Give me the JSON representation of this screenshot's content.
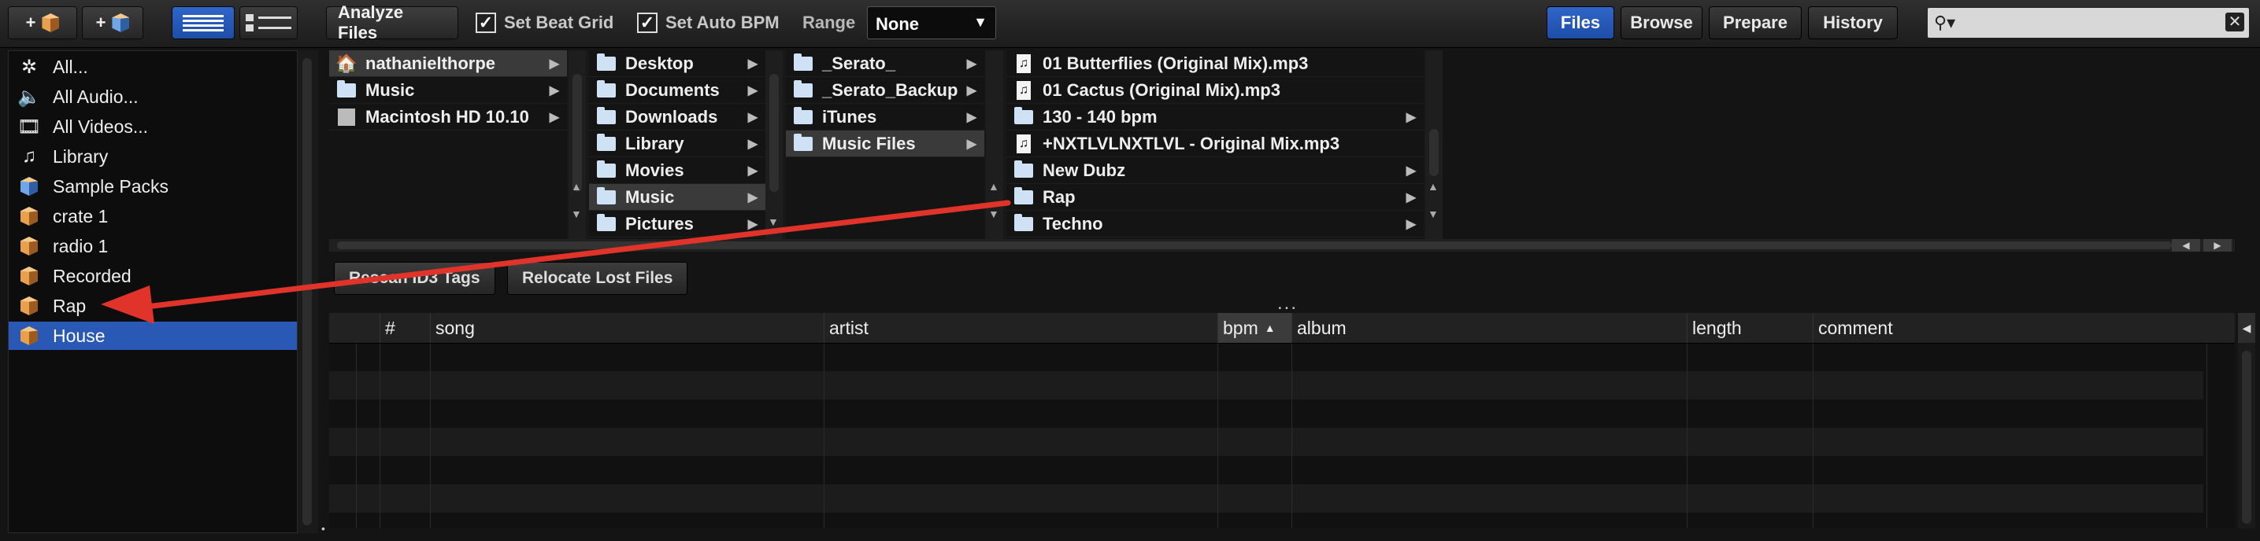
{
  "toolbar": {
    "add_crate": "+",
    "add_smart_crate": "+",
    "analyze_files": "Analyze Files",
    "set_beat_grid": "Set Beat Grid",
    "set_auto_bpm": "Set Auto BPM",
    "range_label": "Range",
    "range_value": "None",
    "tabs": [
      "Files",
      "Browse",
      "Prepare",
      "History"
    ],
    "active_tab": "Files",
    "search_icon": "magnifier-icon",
    "clear_icon": "close-icon"
  },
  "sidebar": {
    "items": [
      {
        "label": "All...",
        "icon": "sparkle-icon"
      },
      {
        "label": "All Audio...",
        "icon": "speaker-icon"
      },
      {
        "label": "All Videos...",
        "icon": "film-icon"
      },
      {
        "label": "Library",
        "icon": "music-notes-icon"
      },
      {
        "label": "Sample Packs",
        "icon": "crate-icon"
      },
      {
        "label": "crate 1",
        "icon": "crate-icon"
      },
      {
        "label": "radio 1",
        "icon": "crate-icon"
      },
      {
        "label": "Recorded",
        "icon": "crate-icon"
      },
      {
        "label": "Rap",
        "icon": "crate-icon"
      },
      {
        "label": "House",
        "icon": "crate-icon"
      }
    ],
    "selected": "House"
  },
  "browser": {
    "col1": [
      {
        "label": "nathanielthorpe",
        "icon": "home-icon",
        "selected": true
      },
      {
        "label": "Music",
        "icon": "folder-icon"
      },
      {
        "label": "Macintosh HD 10.10",
        "icon": "drive-icon"
      }
    ],
    "col2": [
      {
        "label": "Desktop"
      },
      {
        "label": "Documents"
      },
      {
        "label": "Downloads"
      },
      {
        "label": "Library"
      },
      {
        "label": "Movies"
      },
      {
        "label": "Music",
        "selected": true
      },
      {
        "label": "Pictures"
      }
    ],
    "col3": [
      {
        "label": "_Serato_"
      },
      {
        "label": "_Serato_Backup"
      },
      {
        "label": "iTunes"
      },
      {
        "label": "Music Files",
        "selected": true
      }
    ],
    "col4": [
      {
        "label": "01 Butterflies (Original Mix).mp3",
        "type": "file"
      },
      {
        "label": "01 Cactus (Original Mix).mp3",
        "type": "file"
      },
      {
        "label": "130 - 140 bpm",
        "type": "folder"
      },
      {
        "label": "+NXTLVLNXTLVL - Original Mix.mp3",
        "type": "file"
      },
      {
        "label": "New Dubz",
        "type": "folder"
      },
      {
        "label": "Rap",
        "type": "folder"
      },
      {
        "label": "Techno",
        "type": "folder"
      }
    ]
  },
  "actions": {
    "rescan": "Rescan ID3 Tags",
    "relocate": "Relocate Lost Files",
    "dots": "..."
  },
  "table": {
    "columns": [
      "#",
      "song",
      "artist",
      "bpm",
      "album",
      "length",
      "comment"
    ],
    "sorted_column": "bpm",
    "sort_indicator": "▲",
    "scroll_header": "◀"
  },
  "annotation": {
    "color": "#e0332a",
    "from": "Rap folder in file browser",
    "to": "Rap crate in sidebar"
  }
}
